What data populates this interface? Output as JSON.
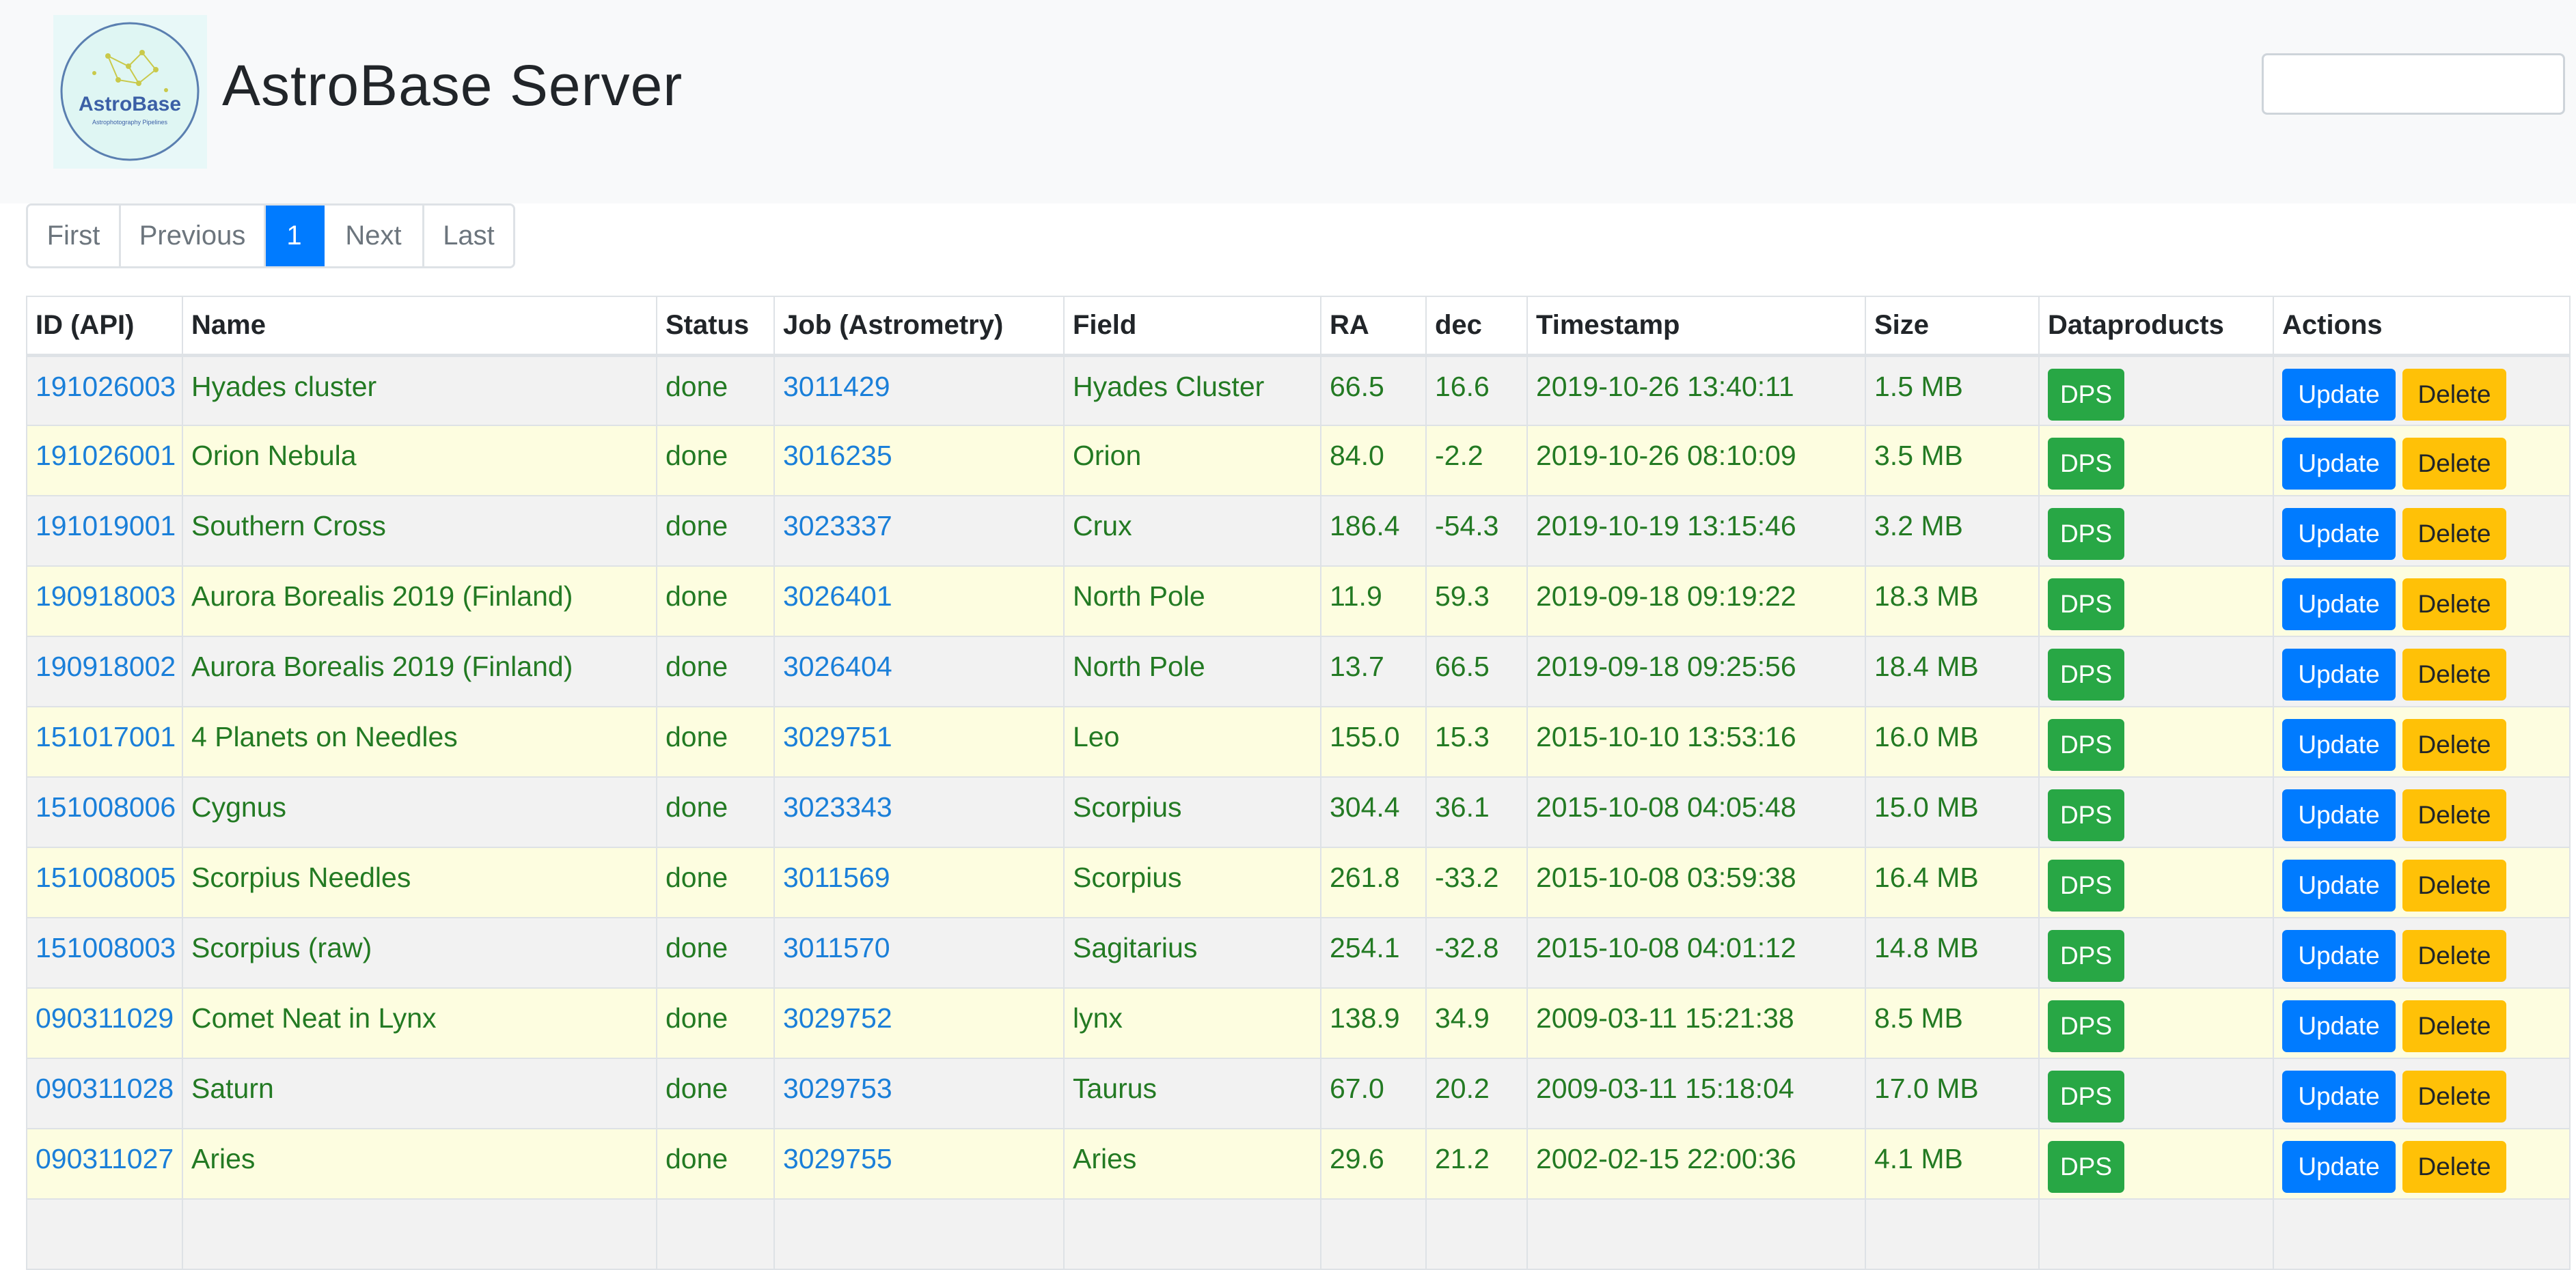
{
  "header": {
    "title": "AstroBase Server",
    "logo_text": "AstroBase",
    "logo_subtext": "Astrophotography Pipelines",
    "search_value": ""
  },
  "pagination": {
    "first": "First",
    "previous": "Previous",
    "current": "1",
    "next": "Next",
    "last": "Last"
  },
  "table": {
    "columns": [
      "ID (API)",
      "Name",
      "Status",
      "Job (Astrometry)",
      "Field",
      "RA",
      "dec",
      "Timestamp",
      "Size",
      "Dataproducts",
      "Actions"
    ],
    "buttons": {
      "dps": "DPS",
      "update": "Update",
      "delete": "Delete"
    },
    "rows": [
      {
        "id": "191026003",
        "name": "Hyades cluster",
        "status": "done",
        "job": "3011429",
        "field": "Hyades Cluster",
        "ra": "66.5",
        "dec": "16.6",
        "timestamp": "2019-10-26 13:40:11",
        "size": "1.5 MB"
      },
      {
        "id": "191026001",
        "name": "Orion Nebula",
        "status": "done",
        "job": "3016235",
        "field": "Orion",
        "ra": "84.0",
        "dec": "-2.2",
        "timestamp": "2019-10-26 08:10:09",
        "size": "3.5 MB"
      },
      {
        "id": "191019001",
        "name": "Southern Cross",
        "status": "done",
        "job": "3023337",
        "field": "Crux",
        "ra": "186.4",
        "dec": "-54.3",
        "timestamp": "2019-10-19 13:15:46",
        "size": "3.2 MB"
      },
      {
        "id": "190918003",
        "name": "Aurora Borealis 2019 (Finland)",
        "status": "done",
        "job": "3026401",
        "field": "North Pole",
        "ra": "11.9",
        "dec": "59.3",
        "timestamp": "2019-09-18 09:19:22",
        "size": "18.3 MB"
      },
      {
        "id": "190918002",
        "name": "Aurora Borealis 2019 (Finland)",
        "status": "done",
        "job": "3026404",
        "field": "North Pole",
        "ra": "13.7",
        "dec": "66.5",
        "timestamp": "2019-09-18 09:25:56",
        "size": "18.4 MB"
      },
      {
        "id": "151017001",
        "name": "4 Planets on Needles",
        "status": "done",
        "job": "3029751",
        "field": "Leo",
        "ra": "155.0",
        "dec": "15.3",
        "timestamp": "2015-10-10 13:53:16",
        "size": "16.0 MB"
      },
      {
        "id": "151008006",
        "name": "Cygnus",
        "status": "done",
        "job": "3023343",
        "field": "Scorpius",
        "ra": "304.4",
        "dec": "36.1",
        "timestamp": "2015-10-08 04:05:48",
        "size": "15.0 MB"
      },
      {
        "id": "151008005",
        "name": "Scorpius Needles",
        "status": "done",
        "job": "3011569",
        "field": "Scorpius",
        "ra": "261.8",
        "dec": "-33.2",
        "timestamp": "2015-10-08 03:59:38",
        "size": "16.4 MB"
      },
      {
        "id": "151008003",
        "name": "Scorpius (raw)",
        "status": "done",
        "job": "3011570",
        "field": "Sagitarius",
        "ra": "254.1",
        "dec": "-32.8",
        "timestamp": "2015-10-08 04:01:12",
        "size": "14.8 MB"
      },
      {
        "id": "090311029",
        "name": "Comet Neat in Lynx",
        "status": "done",
        "job": "3029752",
        "field": "lynx",
        "ra": "138.9",
        "dec": "34.9",
        "timestamp": "2009-03-11 15:21:38",
        "size": "8.5 MB"
      },
      {
        "id": "090311028",
        "name": "Saturn",
        "status": "done",
        "job": "3029753",
        "field": "Taurus",
        "ra": "67.0",
        "dec": "20.2",
        "timestamp": "2009-03-11 15:18:04",
        "size": "17.0 MB"
      },
      {
        "id": "090311027",
        "name": "Aries",
        "status": "done",
        "job": "3029755",
        "field": "Aries",
        "ra": "29.6",
        "dec": "21.2",
        "timestamp": "2002-02-15 22:00:36",
        "size": "4.1 MB"
      },
      {
        "id": "",
        "name": "",
        "status": "",
        "job": "",
        "field": "",
        "ra": "",
        "dec": "",
        "timestamp": "",
        "size": ""
      }
    ]
  },
  "colors": {
    "accent": "#007bff",
    "success": "#28a745",
    "warning": "#ffc107",
    "row_odd": "#f2f2f2",
    "row_even": "#fdfde0",
    "text_green": "#237a23",
    "link": "#1a7fd9"
  }
}
